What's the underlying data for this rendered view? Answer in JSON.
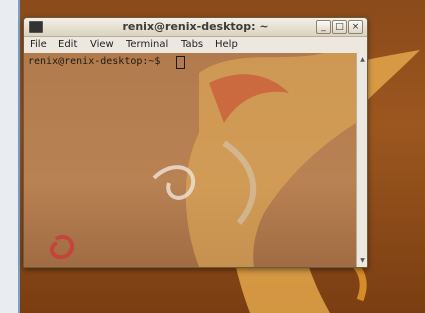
{
  "window": {
    "title": "renix@renix-desktop: ~",
    "minimize_label": "_",
    "maximize_label": "□",
    "close_label": "×"
  },
  "menu": {
    "items": [
      "File",
      "Edit",
      "View",
      "Terminal",
      "Tabs",
      "Help"
    ]
  },
  "terminal": {
    "prompt": "renix@renix-desktop:~$"
  },
  "scrollbar": {
    "up_arrow": "▲",
    "down_arrow": "▼"
  }
}
